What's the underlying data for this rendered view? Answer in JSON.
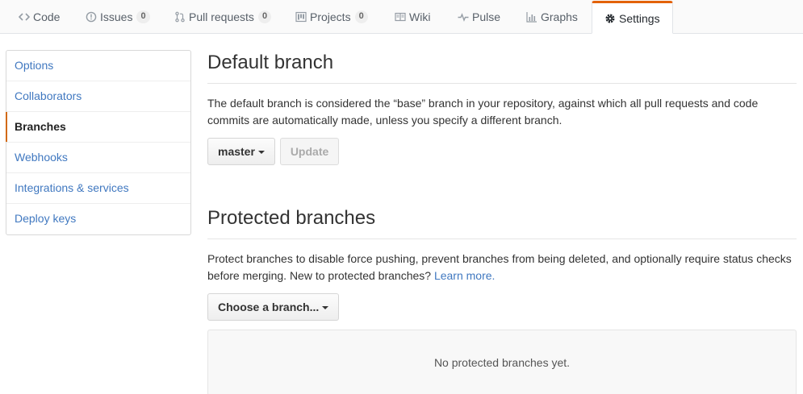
{
  "tabs": [
    {
      "label": "Code",
      "icon": "code-icon"
    },
    {
      "label": "Issues",
      "icon": "issue-opened-icon",
      "count": "0"
    },
    {
      "label": "Pull requests",
      "icon": "git-pull-request-icon",
      "count": "0"
    },
    {
      "label": "Projects",
      "icon": "project-icon",
      "count": "0"
    },
    {
      "label": "Wiki",
      "icon": "book-icon"
    },
    {
      "label": "Pulse",
      "icon": "pulse-icon"
    },
    {
      "label": "Graphs",
      "icon": "graph-icon"
    },
    {
      "label": "Settings",
      "icon": "gear-icon",
      "selected": true
    }
  ],
  "sidebar": {
    "items": [
      {
        "label": "Options"
      },
      {
        "label": "Collaborators"
      },
      {
        "label": "Branches",
        "selected": true
      },
      {
        "label": "Webhooks"
      },
      {
        "label": "Integrations & services"
      },
      {
        "label": "Deploy keys"
      }
    ]
  },
  "default_branch": {
    "title": "Default branch",
    "description": "The default branch is considered the “base” branch in your repository, against which all pull requests and code commits are automatically made, unless you specify a different branch.",
    "branch_button": "master",
    "update_button": "Update"
  },
  "protected_branches": {
    "title": "Protected branches",
    "description": "Protect branches to disable force pushing, prevent branches from being deleted, and optionally require status checks before merging. New to protected branches?",
    "learn_more": "Learn more.",
    "choose_button": "Choose a branch...",
    "empty_message": "No protected branches yet."
  },
  "colors": {
    "link": "#4078c0",
    "selected_tab_accent": "#e36209",
    "selected_menu_accent": "#d26911"
  }
}
